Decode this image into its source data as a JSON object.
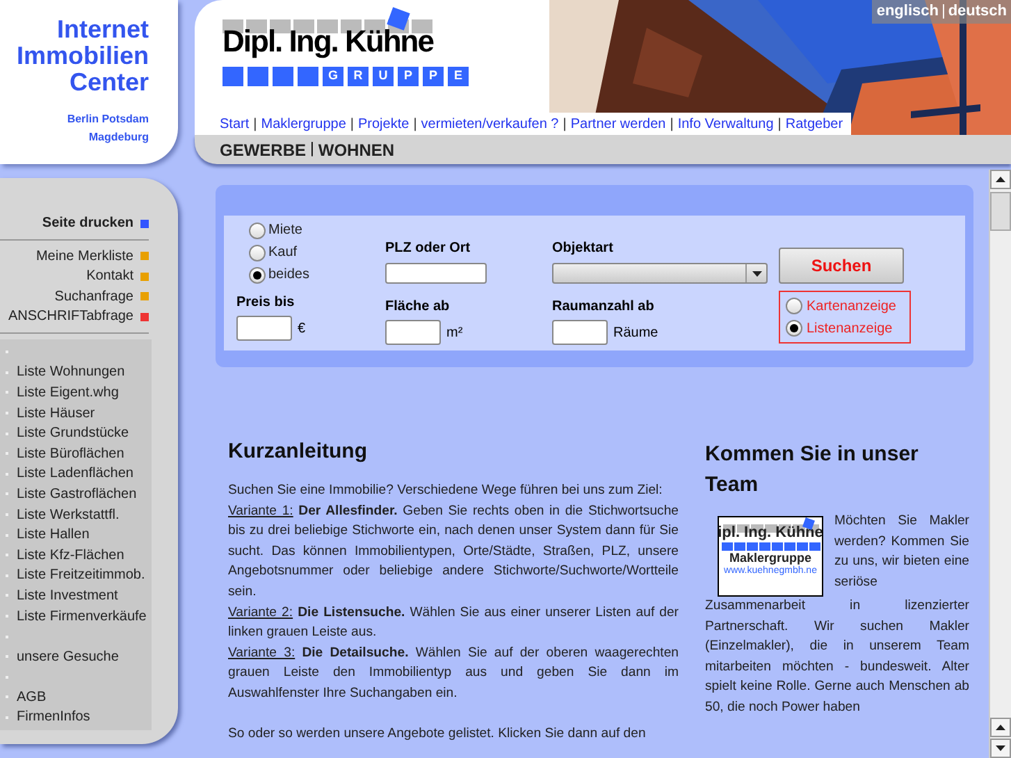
{
  "brand": {
    "lines": [
      "Internet",
      "Immobilien",
      "Center"
    ],
    "cities": [
      "Berlin Potsdam",
      "Magdeburg"
    ]
  },
  "logo": {
    "name": "Dipl. Ing. Kühne",
    "letters": [
      "G",
      "R",
      "U",
      "P",
      "P",
      "E"
    ]
  },
  "separator": "|",
  "language_links": [
    "englisch",
    "deutsch"
  ],
  "nav": [
    "Start",
    "Maklergruppe",
    "Projekte",
    "vermieten/verkaufen ?",
    "Partner werden",
    "Info Verwaltung",
    "Ratgeber"
  ],
  "category_bar": [
    "GEWERBE",
    "WOHNEN"
  ],
  "sidebar": {
    "print": {
      "label": "Seite drucken",
      "color": "#3355ff"
    },
    "tools": [
      {
        "label": "Meine Merkliste",
        "color": "#e8a000"
      },
      {
        "label": "Kontakt",
        "color": "#e8a000"
      },
      {
        "label": "Suchanfrage",
        "color": "#e8a000"
      },
      {
        "label": "ANSCHRIFTabfrage",
        "color": "#ee3333"
      }
    ],
    "lists": [
      {
        "kind": "blank"
      },
      {
        "kind": "link",
        "label": "Liste Wohnungen"
      },
      {
        "kind": "link",
        "label": "Liste Eigent.whg"
      },
      {
        "kind": "link",
        "label": "Liste Häuser"
      },
      {
        "kind": "link",
        "label": "Liste Grundstücke"
      },
      {
        "kind": "link",
        "label": "Liste Büroflächen"
      },
      {
        "kind": "link",
        "label": "Liste Ladenflächen"
      },
      {
        "kind": "link",
        "label": "Liste Gastroflächen"
      },
      {
        "kind": "link",
        "label": "Liste Werkstattfl."
      },
      {
        "kind": "link",
        "label": "Liste Hallen"
      },
      {
        "kind": "link",
        "label": "Liste Kfz-Flächen"
      },
      {
        "kind": "link",
        "label": "Liste Freitzeitimmob."
      },
      {
        "kind": "link",
        "label": "Liste Investment"
      },
      {
        "kind": "link",
        "label": "Liste Firmenverkäufe"
      },
      {
        "kind": "blank"
      },
      {
        "kind": "link",
        "label": "unsere Gesuche"
      },
      {
        "kind": "blank"
      },
      {
        "kind": "link",
        "label": "AGB"
      },
      {
        "kind": "link",
        "label": "FirmenInfos"
      }
    ]
  },
  "search": {
    "offer_type": [
      {
        "label": "Miete",
        "selected": false
      },
      {
        "label": "Kauf",
        "selected": false
      },
      {
        "label": "beides",
        "selected": true
      }
    ],
    "location": {
      "label": "PLZ oder Ort"
    },
    "object_type": {
      "label": "Objektart"
    },
    "submit": "Suchen",
    "price": {
      "label": "Preis bis",
      "unit": "€"
    },
    "area": {
      "label": "Fläche ab",
      "unit": "m²"
    },
    "rooms": {
      "label": "Raumanzahl ab",
      "unit": "Räume"
    },
    "view": [
      {
        "label": "Kartenanzeige",
        "selected": false
      },
      {
        "label": "Listenanzeige",
        "selected": true
      }
    ]
  },
  "guide": {
    "title": "Kurzanleitung",
    "intro": "Suchen Sie eine Immobilie? Verschiedene Wege führen bei uns zum Ziel:",
    "variants": [
      {
        "label": "Variante 1:",
        "text": "**Der Allesfinder.** Geben Sie rechts oben in die Stichwortsuche bis zu drei beliebige Stichworte ein, nach denen unser System dann für Sie sucht. Das können Immobilientypen, Orte/Städte, Straßen, PLZ, unsere Angebotsnummer oder beliebige andere Stichworte/Suchworte/Wortteile sein."
      },
      {
        "label": "Variante 2:",
        "text": "**Die Listensuche.** Wählen Sie aus einer unserer Listen auf der linken grauen Leiste aus."
      },
      {
        "label": "Variante 3:",
        "text": "**Die Detailsuche.** Wählen Sie auf der oberen waagerechten grauen Leiste den Immobilientyp aus und geben Sie dann im Auswahlfenster Ihre Suchangaben ein."
      }
    ],
    "outro": "So oder so werden unsere Angebote gelistet. Klicken Sie dann auf den"
  },
  "team": {
    "title": "Kommen Sie in unser Team",
    "logo_name": "ipl. Ing. Kühne",
    "logo_caption": "Maklergruppe",
    "logo_url": "www.kuehnegmbh.ne",
    "text_beside": "Möchten Sie Makler werden? Kommen Sie zu uns, wir bieten eine seriöse",
    "text_below": "Zusammenarbeit in lizenzierter Partnerschaft. Wir suchen Makler (Einzelmakler), die in unserem Team mitarbeiten möchten - bundesweit. Alter spielt keine Rolle. Gerne auch Menschen ab 50, die noch Power haben"
  }
}
